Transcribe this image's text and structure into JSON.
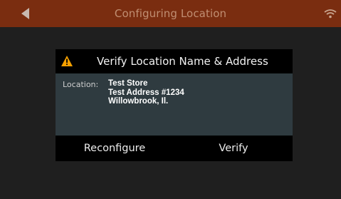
{
  "header": {
    "title": "Configuring Location",
    "back_icon": "back-arrow-icon",
    "status_icon": "wifi-icon",
    "bar_color": "#7a2d10"
  },
  "dialog": {
    "title": "Verify Location Name & Address",
    "warning_icon": "warning-icon",
    "location_label": "Location:",
    "location_lines": [
      "Test Store",
      "Test Address #1234",
      "Willowbrook, Il."
    ],
    "buttons": {
      "reconfigure": "Reconfigure",
      "verify": "Verify"
    },
    "accent_color": "#f5a000",
    "body_color": "#2f3b40"
  }
}
